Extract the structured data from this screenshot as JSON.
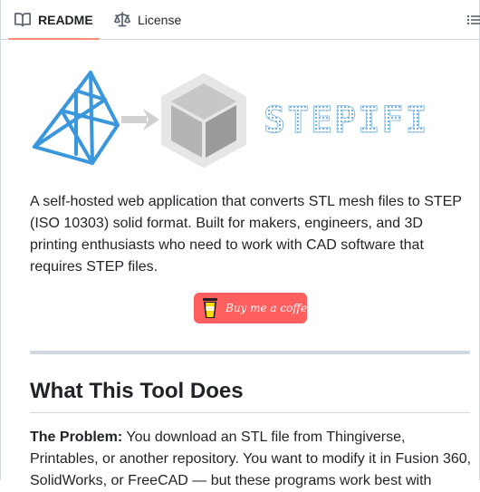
{
  "tabs": {
    "readme": {
      "label": "README",
      "icon": "book-icon"
    },
    "license": {
      "label": "License",
      "icon": "scale-icon"
    },
    "outline_icon": "list-icon"
  },
  "logo": {
    "text": "STEPIFI",
    "colors": {
      "triangle": "#3b97dc",
      "arrow": "#d0d0d0",
      "cube": "#a9a9a9",
      "text": "#7bb1dc"
    }
  },
  "intro": "A self-hosted web application that converts STL mesh files to STEP (ISO 10303) solid format. Built for makers, engineers, and 3D printing enthusiasts who need to work with CAD software that requires STEP files.",
  "coffee_button": {
    "label": "Buy me a coffee",
    "color": "#ff5f5f"
  },
  "section": {
    "heading": "What This Tool Does",
    "problem_label": "The Problem:",
    "problem_text": " You download an STL file from Thingiverse, Printables, or another repository. You want to modify it in Fusion 360, SolidWorks, or FreeCAD — but these programs work best with"
  }
}
